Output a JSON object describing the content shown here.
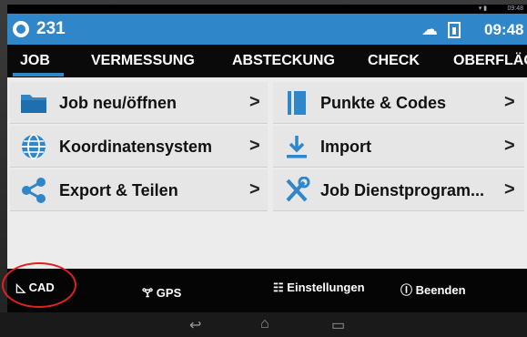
{
  "statusbar": {
    "clock": "09:48"
  },
  "titlebar": {
    "job_number": "231",
    "time": "09:48"
  },
  "tabs": [
    {
      "label": "JOB"
    },
    {
      "label": "VERMESSUNG"
    },
    {
      "label": "ABSTECKUNG"
    },
    {
      "label": "CHECK"
    },
    {
      "label": "OBERFLÄC"
    }
  ],
  "menu": {
    "left": [
      {
        "label": "Job neu/öffnen",
        "icon": "folder-icon"
      },
      {
        "label": "Koordinatensystem",
        "icon": "globe-icon"
      },
      {
        "label": "Export & Teilen",
        "icon": "share-icon"
      }
    ],
    "right": [
      {
        "label": "Punkte & Codes",
        "icon": "points-book-icon"
      },
      {
        "label": "Import",
        "icon": "import-icon"
      },
      {
        "label": "Job Dienstprogram...",
        "icon": "tools-icon"
      }
    ],
    "chevron": ">"
  },
  "bottombar": {
    "cad": "CAD",
    "gps": "GPS",
    "settings": "Einstellungen",
    "exit": "Beenden"
  },
  "colors": {
    "accent": "#2f86c9",
    "annotation": "#e02020"
  }
}
